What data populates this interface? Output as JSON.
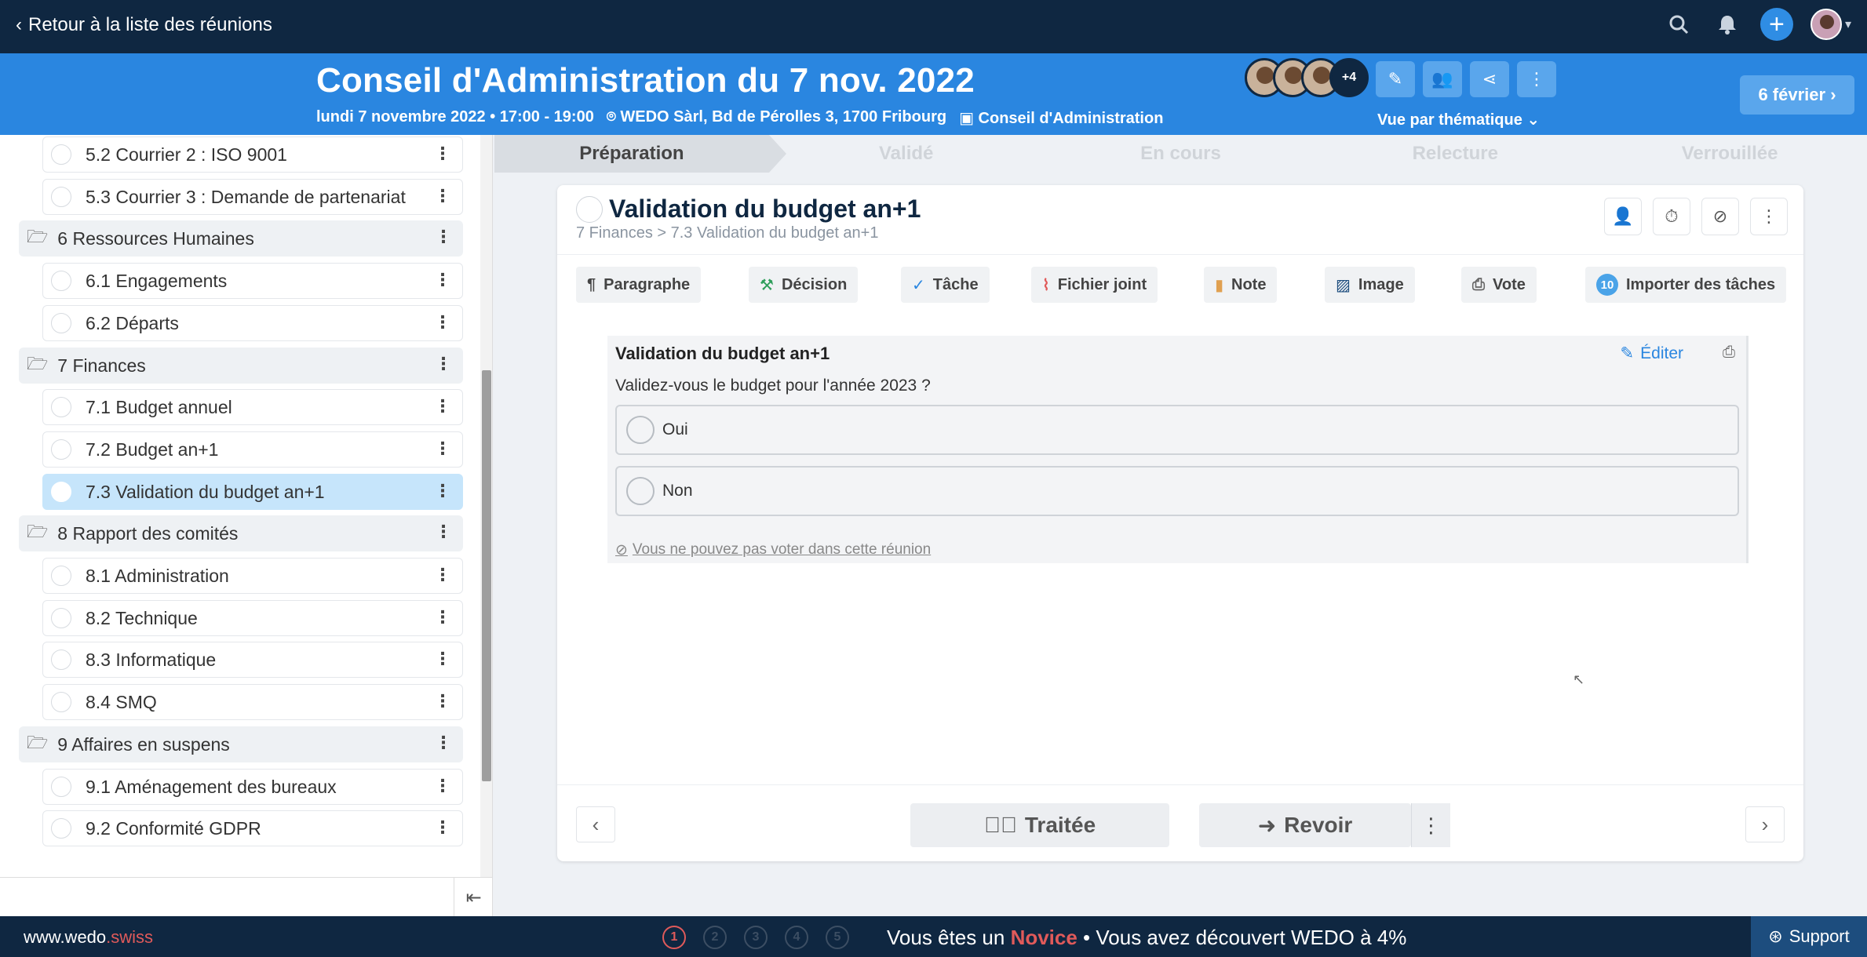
{
  "topbar": {
    "back_label": "Retour à la liste des réunions",
    "icons": [
      "search-icon",
      "bell-icon",
      "plus-icon",
      "user-avatar"
    ]
  },
  "header": {
    "title": "Conseil d'Administration du 7 nov. 2022",
    "datetime": "lundi 7 novembre 2022 • 17:00 - 19:00",
    "location": "WEDO Sàrl, Bd de Pérolles 3, 1700 Fribourg",
    "organ": "Conseil d'Administration",
    "extra_participants": "+4",
    "view_label": "Vue par thématique",
    "next_meeting": "6 février"
  },
  "sidebar": {
    "items": [
      {
        "type": "item",
        "label": "5.2 Courrier 2 : ISO 9001"
      },
      {
        "type": "item",
        "label": "5.3 Courrier 3 : Demande de partenariat"
      },
      {
        "type": "section",
        "label": "6 Ressources Humaines"
      },
      {
        "type": "item",
        "label": "6.1 Engagements"
      },
      {
        "type": "item",
        "label": "6.2 Départs"
      },
      {
        "type": "section",
        "label": "7 Finances"
      },
      {
        "type": "item",
        "label": "7.1 Budget annuel"
      },
      {
        "type": "item",
        "label": "7.2 Budget an+1"
      },
      {
        "type": "item",
        "label": "7.3 Validation du budget an+1",
        "selected": true
      },
      {
        "type": "section",
        "label": "8 Rapport des comités"
      },
      {
        "type": "item",
        "label": "8.1 Administration"
      },
      {
        "type": "item",
        "label": "8.2 Technique"
      },
      {
        "type": "item",
        "label": "8.3 Informatique"
      },
      {
        "type": "item",
        "label": "8.4 SMQ"
      },
      {
        "type": "section",
        "label": "9 Affaires en suspens"
      },
      {
        "type": "item",
        "label": "9.1 Aménagement des bureaux"
      },
      {
        "type": "item",
        "label": "9.2 Conformité GDPR"
      }
    ]
  },
  "steps": [
    "Préparation",
    "Validé",
    "En cours",
    "Relecture",
    "Verrouillée"
  ],
  "topic": {
    "title": "Validation du budget an+1",
    "breadcrumb": "7 Finances > 7.3 Validation du budget an+1"
  },
  "toolbar": {
    "paragraph": "Paragraphe",
    "decision": "Décision",
    "task": "Tâche",
    "attachment": "Fichier joint",
    "note": "Note",
    "image": "Image",
    "vote": "Vote",
    "import_count": "10",
    "import": "Importer des tâches"
  },
  "vote": {
    "title": "Validation du budget an+1",
    "edit_label": "Éditer",
    "question": "Validez-vous le budget pour l'année 2023 ?",
    "options": [
      "Oui",
      "Non"
    ],
    "notice": "Vous ne pouvez pas voter dans cette réunion"
  },
  "actions": {
    "done_label": "Traitée",
    "review_label": "Revoir"
  },
  "footer": {
    "site_prefix": "www.wedo",
    "site_suffix": ".swiss",
    "levels": [
      "1",
      "2",
      "3",
      "4",
      "5"
    ],
    "progress_prefix": "Vous êtes un ",
    "level_name": "Novice",
    "progress_suffix": " • Vous avez découvert WEDO à 4%",
    "support_label": "Support"
  }
}
